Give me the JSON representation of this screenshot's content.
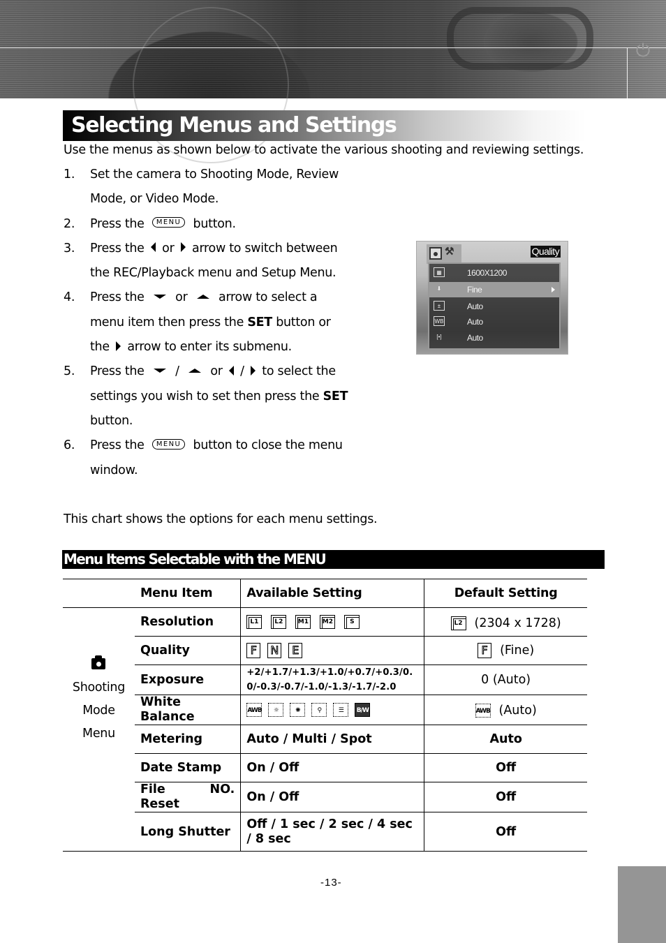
{
  "header": {
    "banner_image": "camera-closeup-photo",
    "power_icon": "power-icon"
  },
  "page_title": "Selecting Menus and Settings",
  "intro": "Use the menus as shown below to activate the various shooting and reviewing settings.",
  "steps": [
    {
      "num": "1.",
      "lines": [
        "Set the camera to Shooting Mode, Review",
        "Mode, or Video Mode."
      ]
    },
    {
      "num": "2.",
      "pre": "Press the",
      "button": "MENU",
      "post": "button."
    },
    {
      "num": "3.",
      "pre": "Press the",
      "mid": "or",
      "post": "arrow to switch between",
      "line2": "the REC/Playback menu and Setup Menu."
    },
    {
      "num": "4.",
      "pre": "Press the",
      "mid": "or",
      "post": "arrow to select a",
      "line2_pre": "menu item then press the",
      "line2_bold": "SET",
      "line2_post": "button or",
      "line3_pre": "the",
      "line3_post": "arrow to enter its submenu."
    },
    {
      "num": "5.",
      "pre": "Press the",
      "slash": "/",
      "mid": "or",
      "post": "to select the",
      "line2_pre": "settings you wish to set then press the",
      "line2_bold": "SET",
      "line3": "button."
    },
    {
      "num": "6.",
      "pre": "Press the",
      "button": "MENU",
      "post": "button to close the menu",
      "line2": "window."
    }
  ],
  "lcd": {
    "tag": "Quality",
    "rows": [
      {
        "icon": "resolution-icon",
        "value": "1600X1200",
        "selected": false
      },
      {
        "icon": "quality-icon",
        "value": "Fine",
        "selected": true
      },
      {
        "icon": "exposure-icon",
        "value": "Auto",
        "selected": false
      },
      {
        "icon": "white-balance-icon",
        "icon_text": "WB",
        "value": "Auto",
        "selected": false
      },
      {
        "icon": "metering-icon",
        "icon_text": "[•]",
        "value": "Auto",
        "selected": false
      }
    ]
  },
  "chart_note": "This chart shows the options for each menu settings.",
  "section_title": "Menu Items Selectable with the MENU",
  "table": {
    "headers": [
      "Menu Item",
      "Available Setting",
      "Default Setting"
    ],
    "group": {
      "icon": "camera-icon",
      "lines": [
        "Shooting",
        "Mode",
        "Menu"
      ]
    },
    "rows": [
      {
        "item": "Resolution",
        "available_icons": [
          "L1",
          "L2",
          "M1",
          "M2",
          "S"
        ],
        "default_icon": "L2",
        "default": "(2304 x 1728)"
      },
      {
        "item": "Quality",
        "available_icons": [
          "F",
          "N",
          "E"
        ],
        "default_icon": "F",
        "default": "(Fine)"
      },
      {
        "item": "Exposure",
        "available_lines": [
          "+2/+1.7/+1.3/+1.0/+0.7/+0.3/0.",
          "0/-0.3/-0.7/-1.0/-1.3/-1.7/-2.0"
        ],
        "default": "0 (Auto)"
      },
      {
        "item_lines": [
          "White",
          "Balance"
        ],
        "available_icons": [
          "AWB",
          "DAY",
          "TUNG",
          "FLUO",
          "CLOUD",
          "B/W"
        ],
        "default_icon": "AWB",
        "default": "(Auto)"
      },
      {
        "item": "Metering",
        "available": "Auto / Multi / Spot",
        "default": "Auto"
      },
      {
        "item": "Date Stamp",
        "available": "On / Off",
        "default": "Off"
      },
      {
        "item_lines": [
          "File",
          "NO.",
          "Reset"
        ],
        "available": "On / Off",
        "default": "Off"
      },
      {
        "item": "Long Shutter",
        "available_lines": [
          "Off / 1 sec / 2 sec / 4 sec",
          "/ 8 sec"
        ],
        "default": "Off"
      }
    ]
  },
  "page_number": "-13-"
}
